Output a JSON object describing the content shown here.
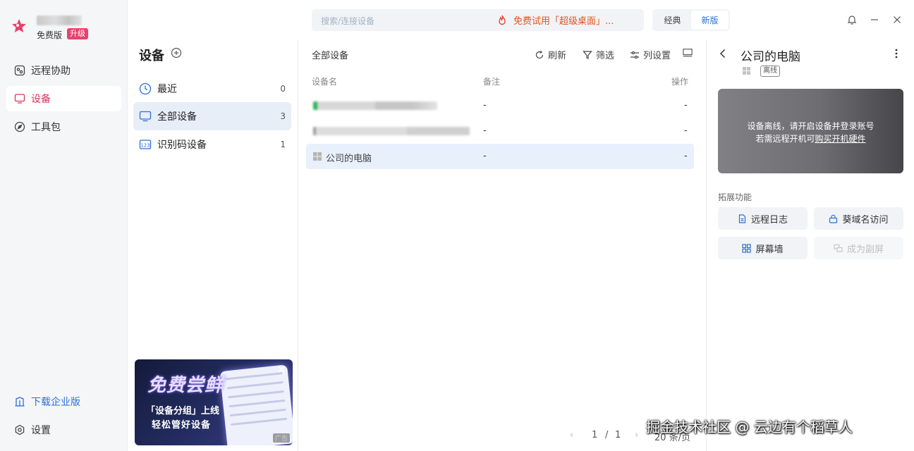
{
  "colors": {
    "accent": "#d6365c",
    "link": "#2b6fd6",
    "promo": "#e2541c",
    "badge": "#e8426c"
  },
  "account": {
    "edition": "免费版",
    "upgrade": "升级"
  },
  "sidebar": {
    "items": [
      {
        "label": "远程协助",
        "icon": "remote-assist-icon"
      },
      {
        "label": "设备",
        "icon": "monitor-icon",
        "active": true
      },
      {
        "label": "工具包",
        "icon": "compass-icon"
      }
    ],
    "enterprise": "下载企业版",
    "settings": "设置"
  },
  "topbar": {
    "search_placeholder": "搜索/连接设备",
    "promo": "免费试用「超级桌面」...",
    "modes": [
      "经典",
      "新版"
    ],
    "active_mode": "新版"
  },
  "groups": {
    "title": "设备",
    "items": [
      {
        "label": "最近",
        "count": "0"
      },
      {
        "label": "全部设备",
        "count": "3"
      },
      {
        "label": "识别码设备",
        "count": "1"
      }
    ]
  },
  "ad": {
    "headline": "免费尝鲜",
    "line1": "「设备分组」上线",
    "line2": "轻松管好设备",
    "tag": "广告"
  },
  "list": {
    "heading": "全部设备",
    "toolbar": {
      "refresh": "刷新",
      "filter": "筛选",
      "columns": "列设置"
    },
    "columns": {
      "name": "设备名",
      "note": "备注",
      "action": "操作"
    },
    "rows": [
      {
        "name": "",
        "note": "-",
        "action": "-"
      },
      {
        "name": "",
        "note": "-",
        "action": "-"
      },
      {
        "name": "公司的电脑",
        "note": "-",
        "action": "-"
      }
    ]
  },
  "detail": {
    "title": "公司的电脑",
    "status": "离线",
    "offline_msg": "设备离线，请开启设备并登录账号",
    "offline_hint_prefix": "若需远程开机可",
    "offline_hint_link": "购买开机硬件",
    "ext_title": "拓展功能",
    "ext": {
      "log": "远程日志",
      "domain": "葵域名访问",
      "wall": "屏幕墙",
      "sub": "成为副屏"
    }
  },
  "pager": {
    "current": "1",
    "sep": "/",
    "total": "1",
    "per_page": "20 条/页"
  },
  "watermark": "掘金技术社区 @ 云边有个稻草人"
}
